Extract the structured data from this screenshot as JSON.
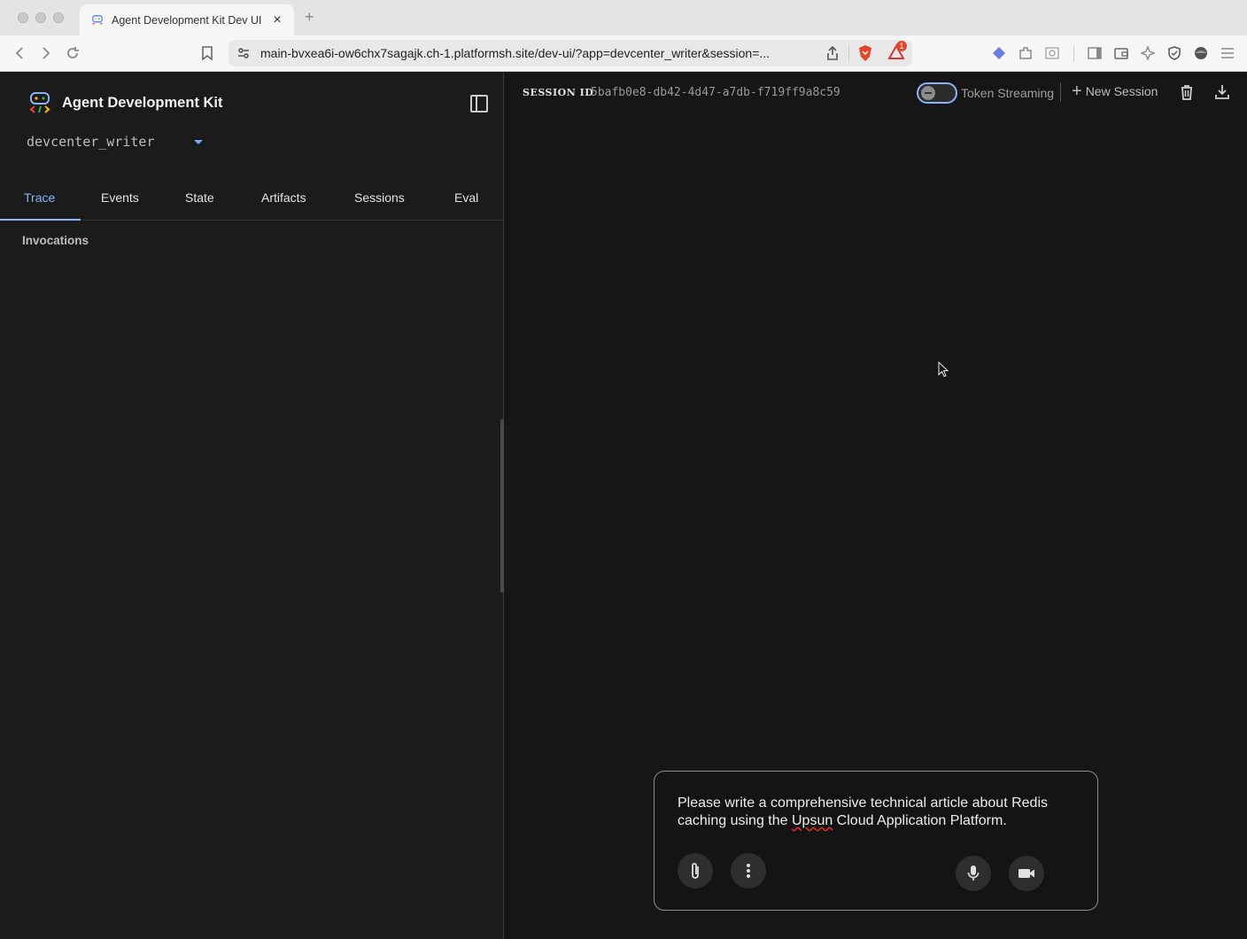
{
  "browser": {
    "tab_title": "Agent Development Kit Dev UI",
    "tab_close": "×",
    "new_tab": "+",
    "url": "main-bvxea6i-ow6chx7sagajk.ch-1.platformsh.site/dev-ui/?app=devcenter_writer&session=...",
    "alert_badge": "1"
  },
  "sidebar": {
    "brand_title": "Agent Development Kit",
    "app_selector": "devcenter_writer",
    "tabs": [
      {
        "label": "Trace",
        "active": true
      },
      {
        "label": "Events",
        "active": false
      },
      {
        "label": "State",
        "active": false
      },
      {
        "label": "Artifacts",
        "active": false
      },
      {
        "label": "Sessions",
        "active": false
      },
      {
        "label": "Eval",
        "active": false
      }
    ],
    "section_title": "Invocations"
  },
  "header": {
    "session_label": "SESSION ID",
    "session_id": "5bafb0e8-db42-4d47-a7db-f719ff9a8c59",
    "token_streaming_label": "Token Streaming",
    "token_streaming_on": false,
    "new_session_label": "New Session"
  },
  "composer": {
    "text_before": "Please write a comprehensive technical article about Redis caching using the ",
    "text_misspelled": "Upsun",
    "text_after": " Cloud Application Platform."
  },
  "colors": {
    "accent": "#8ab4f8",
    "background": "#161616",
    "sidebar_bg": "#1b1b1b"
  }
}
